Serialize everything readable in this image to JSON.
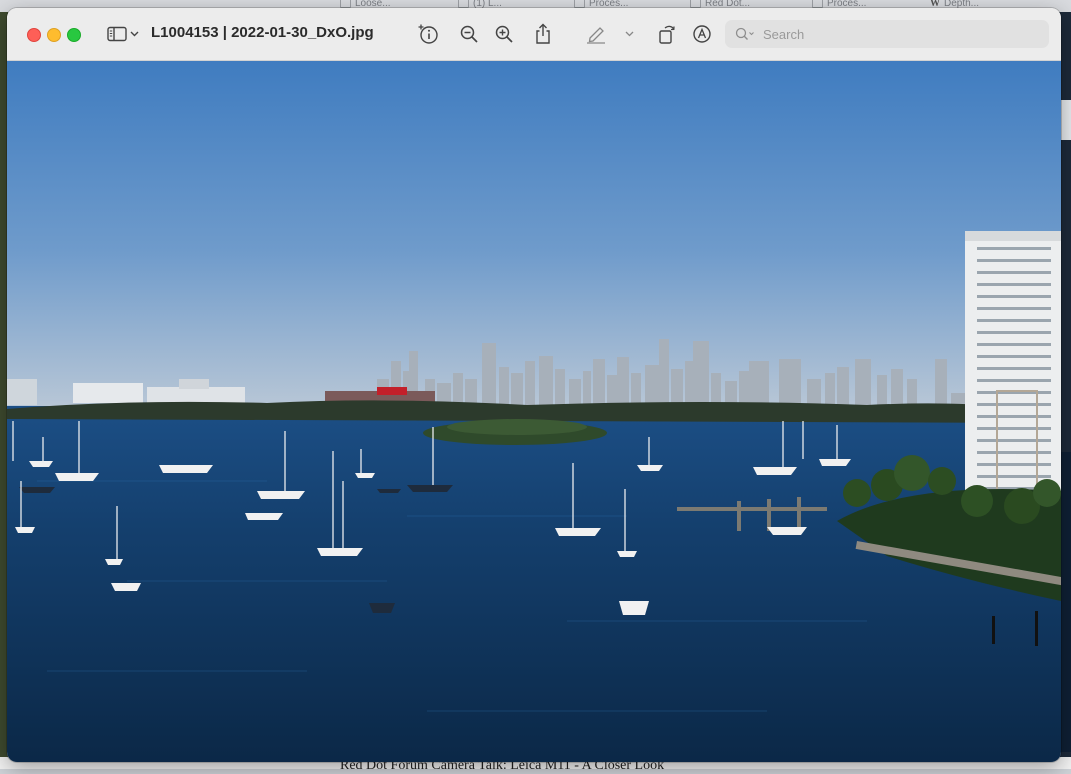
{
  "background": {
    "tabs": [
      "Loose...",
      "(1) L...",
      "Proces...",
      "Proces...",
      "Red Dot...",
      "Proces...",
      "Depth..."
    ],
    "article_title": "Red Dot Forum Camera Talk: Leica M11 - A Closer Look"
  },
  "window": {
    "title": "L1004153 | 2022-01-30_DxO.jpg",
    "search_placeholder": "Search"
  },
  "toolbar_icons": [
    "sidebar-icon",
    "chevron-down-icon",
    "info-icon",
    "zoom-out-icon",
    "zoom-in-icon",
    "share-icon",
    "markup-pen-icon",
    "rotate-icon",
    "annotate-icon",
    "search-icon"
  ],
  "colors": {
    "close": "#fe5f57",
    "minimize": "#febc2e",
    "maximize": "#28c840",
    "sky_top": "#3f7cc0",
    "sky_horizon": "#b7c6d6",
    "water": "#0f3259"
  }
}
